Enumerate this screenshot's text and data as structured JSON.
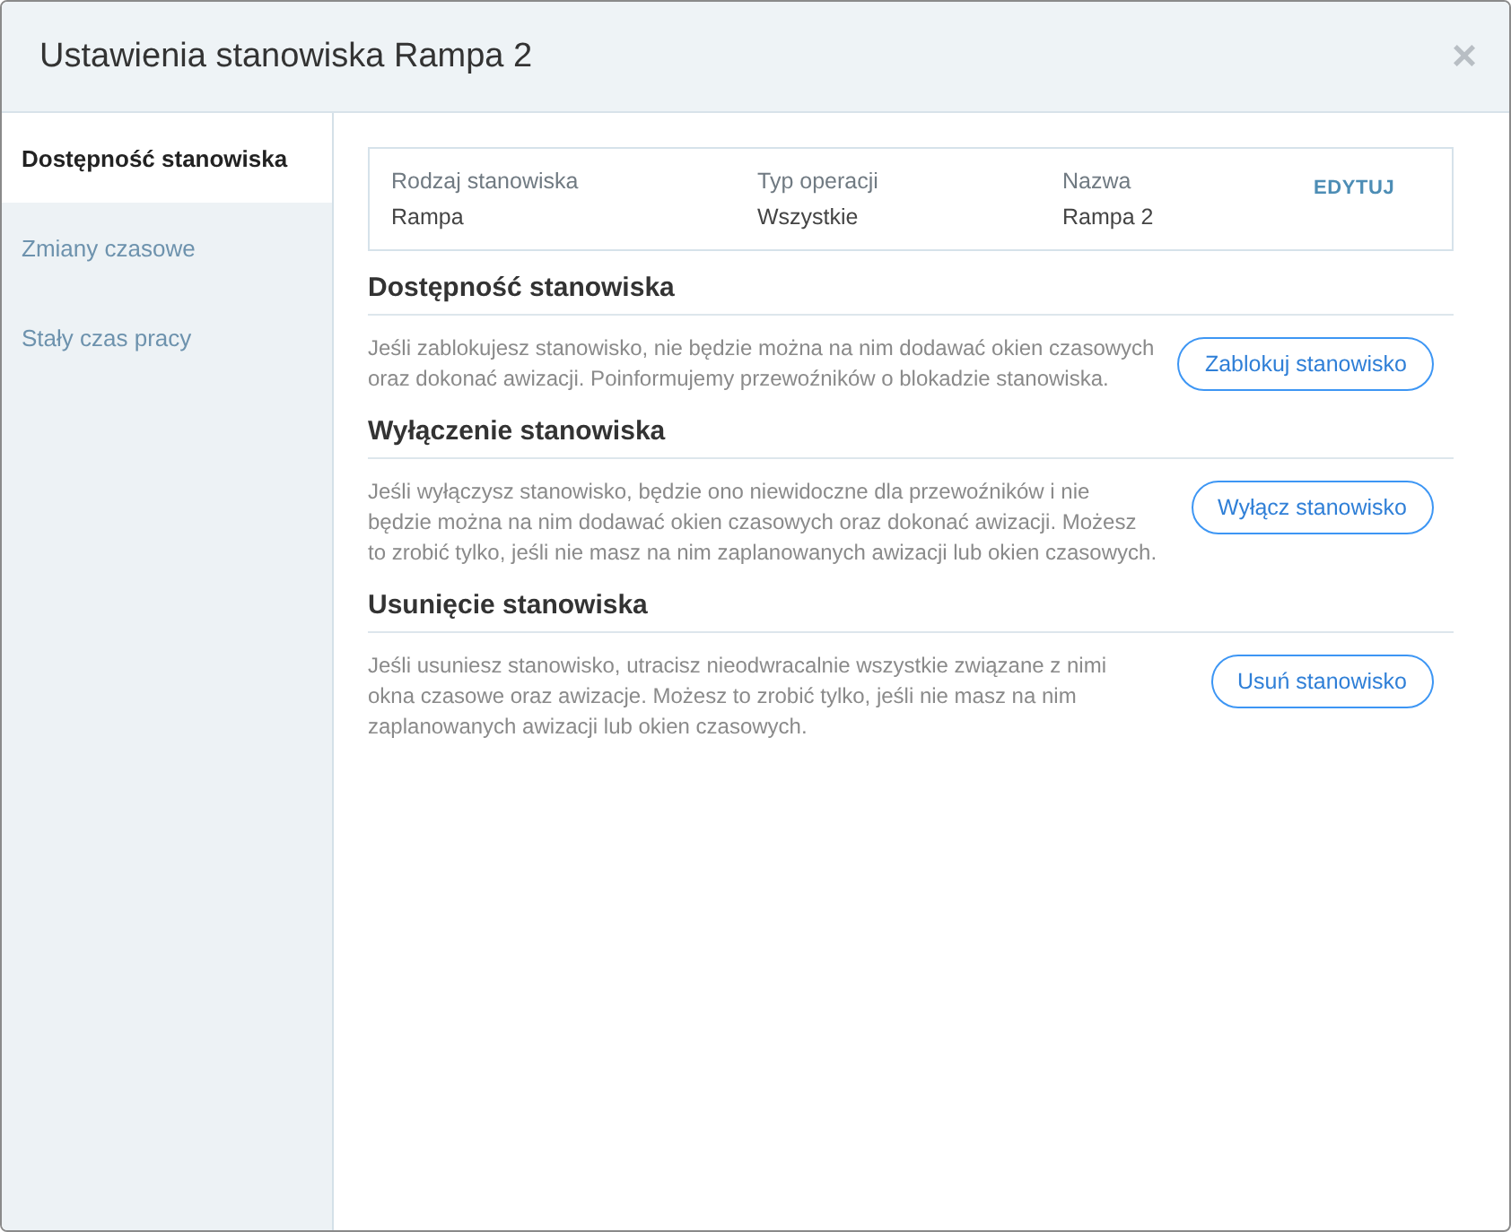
{
  "window": {
    "title": "Ustawienia stanowiska Rampa 2",
    "close": "×"
  },
  "sidebar": {
    "items": [
      {
        "label": "Dostępność stanowiska",
        "selected": true
      },
      {
        "label": "Zmiany czasowe",
        "selected": false
      },
      {
        "label": "Stały czas pracy",
        "selected": false
      }
    ]
  },
  "info": {
    "fields": [
      {
        "label": "Rodzaj stanowiska",
        "value": "Rampa"
      },
      {
        "label": "Typ operacji",
        "value": "Wszystkie"
      },
      {
        "label": "Nazwa",
        "value": "Rampa 2"
      }
    ],
    "edit_link": "EDYTUJ"
  },
  "sections": [
    {
      "title": "Dostępność stanowiska",
      "text": "Jeśli zablokujesz stanowisko, nie będzie można na nim dodawać okien czasowych oraz dokonać awizacji. Poinformujemy przewoźników o blokadzie stanowiska.",
      "button": "Zablokuj stanowisko"
    },
    {
      "title": "Wyłączenie stanowiska",
      "text": "Jeśli wyłączysz stanowisko, będzie ono niewidoczne dla przewoźników i nie będzie można na nim dodawać okien czasowych oraz dokonać awizacji. Możesz to zrobić tylko, jeśli nie masz na nim zaplanowanych awizacji lub okien czasowych.",
      "button": "Wyłącz stanowisko"
    },
    {
      "title": "Usunięcie stanowiska",
      "text": "Jeśli usuniesz stanowisko, utracisz nieodwracalnie wszystkie związane z nimi okna czasowe oraz awizacje. Możesz to zrobić tylko, jeśli nie masz na nim zaplanowanych awizacji lub okien czasowych.",
      "button": "Usuń stanowisko"
    }
  ]
}
